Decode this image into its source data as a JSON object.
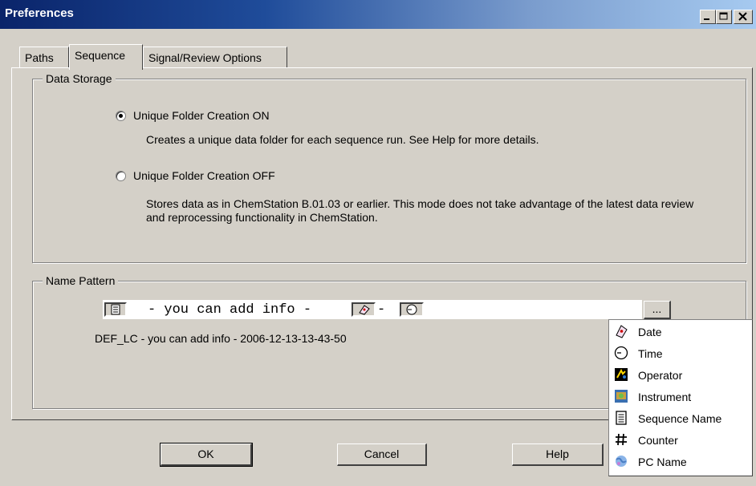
{
  "window": {
    "title": "Preferences"
  },
  "tabs": [
    {
      "label": "Paths",
      "active": false
    },
    {
      "label": "Sequence",
      "active": true
    },
    {
      "label": "Signal/Review Options",
      "active": false
    }
  ],
  "data_storage": {
    "legend": "Data Storage",
    "options": [
      {
        "label": "Unique Folder Creation ON",
        "selected": true,
        "description": "Creates a unique data folder for each sequence run. See Help for more details."
      },
      {
        "label": "Unique Folder Creation OFF",
        "selected": false,
        "description": "Stores data as in ChemStation B.01.03 or earlier. This mode does not take advantage of the latest data review and reprocessing functionality in ChemStation."
      }
    ]
  },
  "name_pattern": {
    "legend": "Name Pattern",
    "pattern_text": "- you can add info -",
    "separator": "-",
    "browse_label": "...",
    "preview": "DEF_LC - you can add info - 2006-12-13-13-43-50"
  },
  "buttons": {
    "ok": "OK",
    "cancel": "Cancel",
    "help": "Help"
  },
  "token_menu": {
    "items": [
      {
        "label": "Date",
        "icon": "date-icon"
      },
      {
        "label": "Time",
        "icon": "time-icon"
      },
      {
        "label": "Operator",
        "icon": "operator-icon"
      },
      {
        "label": "Instrument",
        "icon": "instrument-icon"
      },
      {
        "label": "Sequence Name",
        "icon": "sequence-name-icon"
      },
      {
        "label": "Counter",
        "icon": "counter-icon"
      },
      {
        "label": "PC Name",
        "icon": "pc-name-icon"
      }
    ]
  },
  "colors": {
    "titlebar_start": "#0a246a",
    "titlebar_end": "#a6caf0",
    "face": "#d4d0c8"
  }
}
